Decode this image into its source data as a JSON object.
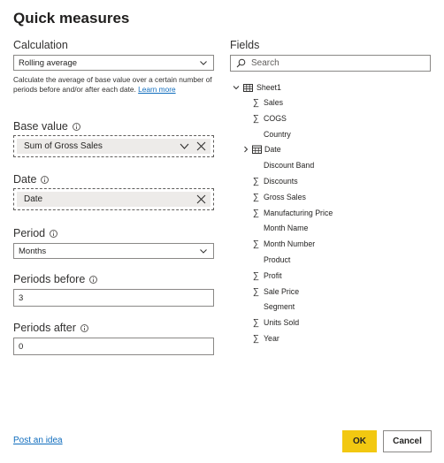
{
  "dialog": {
    "title": "Quick measures"
  },
  "calculation": {
    "label": "Calculation",
    "selected": "Rolling average",
    "description": "Calculate the average of base value over a certain number of periods before and/or after each date.",
    "learn_more": "Learn more"
  },
  "base_value": {
    "label": "Base value",
    "value": "Sum of Gross Sales"
  },
  "date": {
    "label": "Date",
    "value": "Date"
  },
  "period": {
    "label": "Period",
    "selected": "Months"
  },
  "periods_before": {
    "label": "Periods before",
    "value": "3"
  },
  "periods_after": {
    "label": "Periods after",
    "value": "0"
  },
  "fields": {
    "label": "Fields",
    "search_placeholder": "Search",
    "table": "Sheet1",
    "items": [
      {
        "name": "Sales",
        "icon": "sigma-icon"
      },
      {
        "name": "COGS",
        "icon": "sigma-icon"
      },
      {
        "name": "Country",
        "icon": ""
      },
      {
        "name": "Date",
        "icon": "calendar-icon"
      },
      {
        "name": "Discount Band",
        "icon": ""
      },
      {
        "name": "Discounts",
        "icon": "sigma-icon"
      },
      {
        "name": "Gross Sales",
        "icon": "sigma-icon"
      },
      {
        "name": "Manufacturing Price",
        "icon": "sigma-icon"
      },
      {
        "name": "Month Name",
        "icon": ""
      },
      {
        "name": "Month Number",
        "icon": "sigma-icon"
      },
      {
        "name": "Product",
        "icon": ""
      },
      {
        "name": "Profit",
        "icon": "sigma-icon"
      },
      {
        "name": "Sale Price",
        "icon": "sigma-icon"
      },
      {
        "name": "Segment",
        "icon": ""
      },
      {
        "name": "Units Sold",
        "icon": "sigma-icon"
      },
      {
        "name": "Year",
        "icon": "sigma-icon"
      }
    ]
  },
  "footer": {
    "post_idea": "Post an idea",
    "ok": "OK",
    "cancel": "Cancel"
  },
  "colors": {
    "accent_yellow": "#f2c811",
    "link_blue": "#0f6cbd",
    "pill_gray": "#edebe9"
  }
}
